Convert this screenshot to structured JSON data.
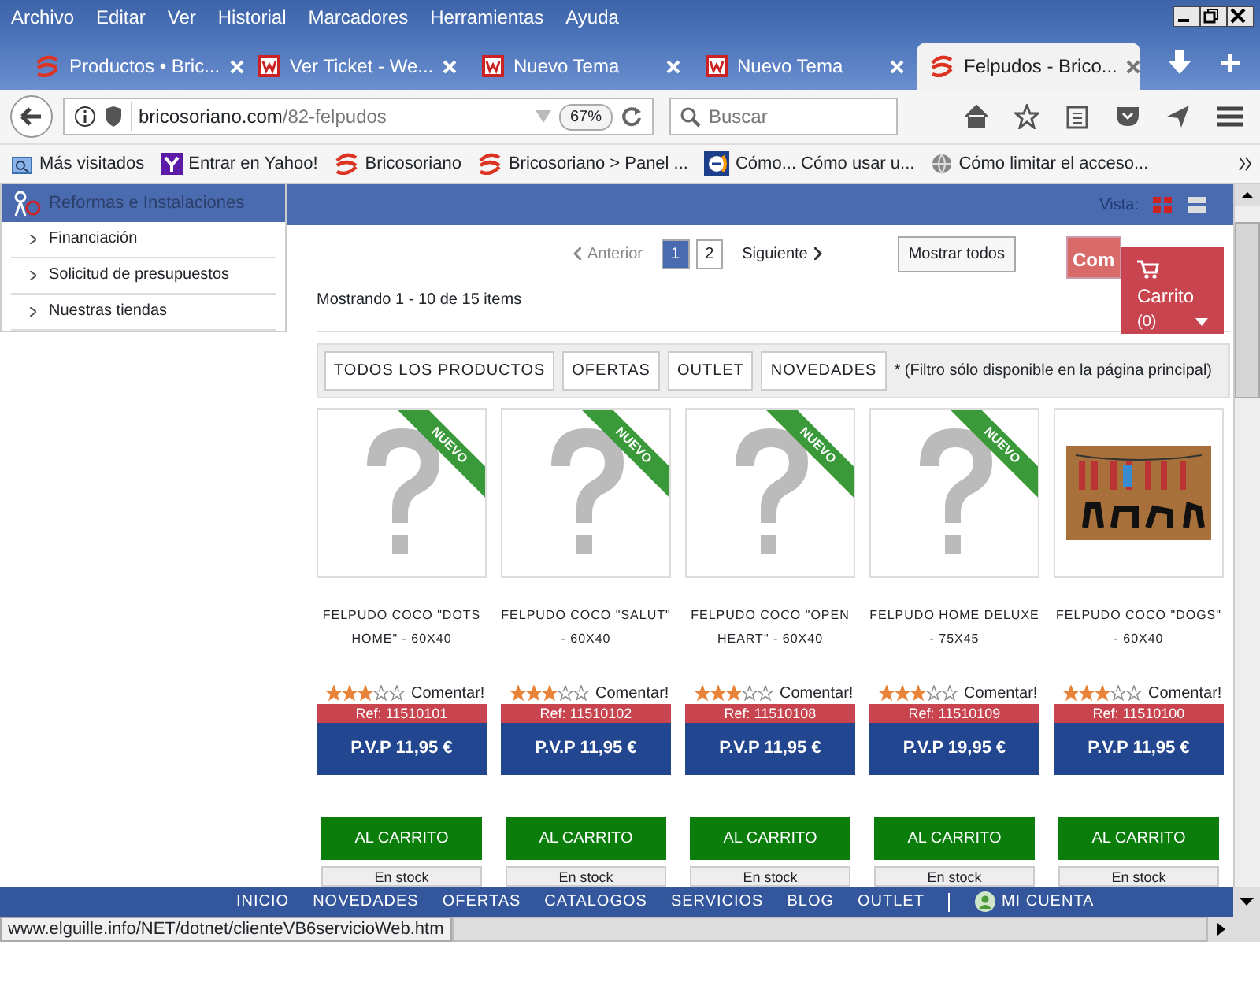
{
  "menu": [
    "Archivo",
    "Editar",
    "Ver",
    "Historial",
    "Marcadores",
    "Herramientas",
    "Ayuda"
  ],
  "tabs": [
    {
      "title": "Productos • Bric...",
      "kind": "swirl",
      "selected": false
    },
    {
      "title": "Ver Ticket - We...",
      "kind": "w",
      "selected": false
    },
    {
      "title": "Nuevo Tema",
      "kind": "w",
      "selected": false
    },
    {
      "title": "Nuevo Tema",
      "kind": "w",
      "selected": false
    },
    {
      "title": "Felpudos - Brico...",
      "kind": "swirl",
      "selected": true
    }
  ],
  "address": {
    "host": "bricosoriano.com",
    "path": "/82-felpudos",
    "zoom": "67%"
  },
  "search": {
    "placeholder": "Buscar"
  },
  "bookmarks": [
    {
      "label": "Más visitados",
      "kind": "folder"
    },
    {
      "label": "Entrar en Yahoo!",
      "kind": "y"
    },
    {
      "label": "Bricosoriano",
      "kind": "swirl"
    },
    {
      "label": "Bricosoriano > Panel ...",
      "kind": "swirl"
    },
    {
      "label": "Cómo... Cómo usar u...",
      "kind": "e"
    },
    {
      "label": "Cómo limitar el acceso...",
      "kind": "globe"
    }
  ],
  "sidebar": {
    "header": "Reformas e Instalaciones",
    "items": [
      "Financiación",
      "Solicitud de presupuestos",
      "Nuestras tiendas"
    ]
  },
  "toolbar": {
    "view_label": "Vista:"
  },
  "pagination": {
    "prev": "Anterior",
    "pages": [
      {
        "label": "1",
        "selected": true
      },
      {
        "label": "2",
        "selected": false
      }
    ],
    "next": "Siguiente",
    "show_all": "Mostrar todos"
  },
  "compare_button": "Com",
  "cart": {
    "title": "Carrito",
    "count": "(0)"
  },
  "results": "Mostrando 1 - 10 de 15 items",
  "filters": {
    "buttons": [
      "TODOS LOS PRODUCTOS",
      "OFERTAS",
      "OUTLET",
      "NOVEDADES"
    ],
    "note": "* (Filtro sólo disponible en la página principal)"
  },
  "products": [
    {
      "name": "FELPUDO COCO \"DOTS HOME\" - 60X40",
      "kind": "placeholder",
      "badge": "NUEVO",
      "stars": 3,
      "comment": "Comentar!",
      "ref": "Ref: 11510101",
      "price": "P.V.P  11,95 €",
      "add": "AL CARRITO",
      "stock": "En stock"
    },
    {
      "name": "FELPUDO COCO \"SALUT\" - 60X40",
      "kind": "placeholder",
      "badge": "NUEVO",
      "stars": 3,
      "comment": "Comentar!",
      "ref": "Ref: 11510102",
      "price": "P.V.P  11,95 €",
      "add": "AL CARRITO",
      "stock": "En stock"
    },
    {
      "name": "FELPUDO COCO \"OPEN HEART\" - 60X40",
      "kind": "placeholder",
      "badge": "NUEVO",
      "stars": 3,
      "comment": "Comentar!",
      "ref": "Ref: 11510108",
      "price": "P.V.P  11,95 €",
      "add": "AL CARRITO",
      "stock": "En stock"
    },
    {
      "name": "FELPUDO HOME DELUXE - 75X45",
      "kind": "placeholder",
      "badge": "NUEVO",
      "stars": 3,
      "comment": "Comentar!",
      "ref": "Ref: 11510109",
      "price": "P.V.P  19,95 €",
      "add": "AL CARRITO",
      "stock": "En stock"
    },
    {
      "name": "FELPUDO COCO \"DOGS\" - 60X40",
      "kind": "doormat",
      "stars": 3,
      "comment": "Comentar!",
      "ref": "Ref: 11510100",
      "price": "P.V.P  11,95 €",
      "add": "AL CARRITO",
      "stock": "En stock"
    }
  ],
  "bottom_nav": [
    "INICIO",
    "NOVEDADES",
    "OFERTAS",
    "CATALOGOS",
    "SERVICIOS",
    "BLOG",
    "OUTLET"
  ],
  "account": "MI CUENTA",
  "status_url": "www.elguille.info/NET/dotnet/clienteVB6servicioWeb.htm"
}
